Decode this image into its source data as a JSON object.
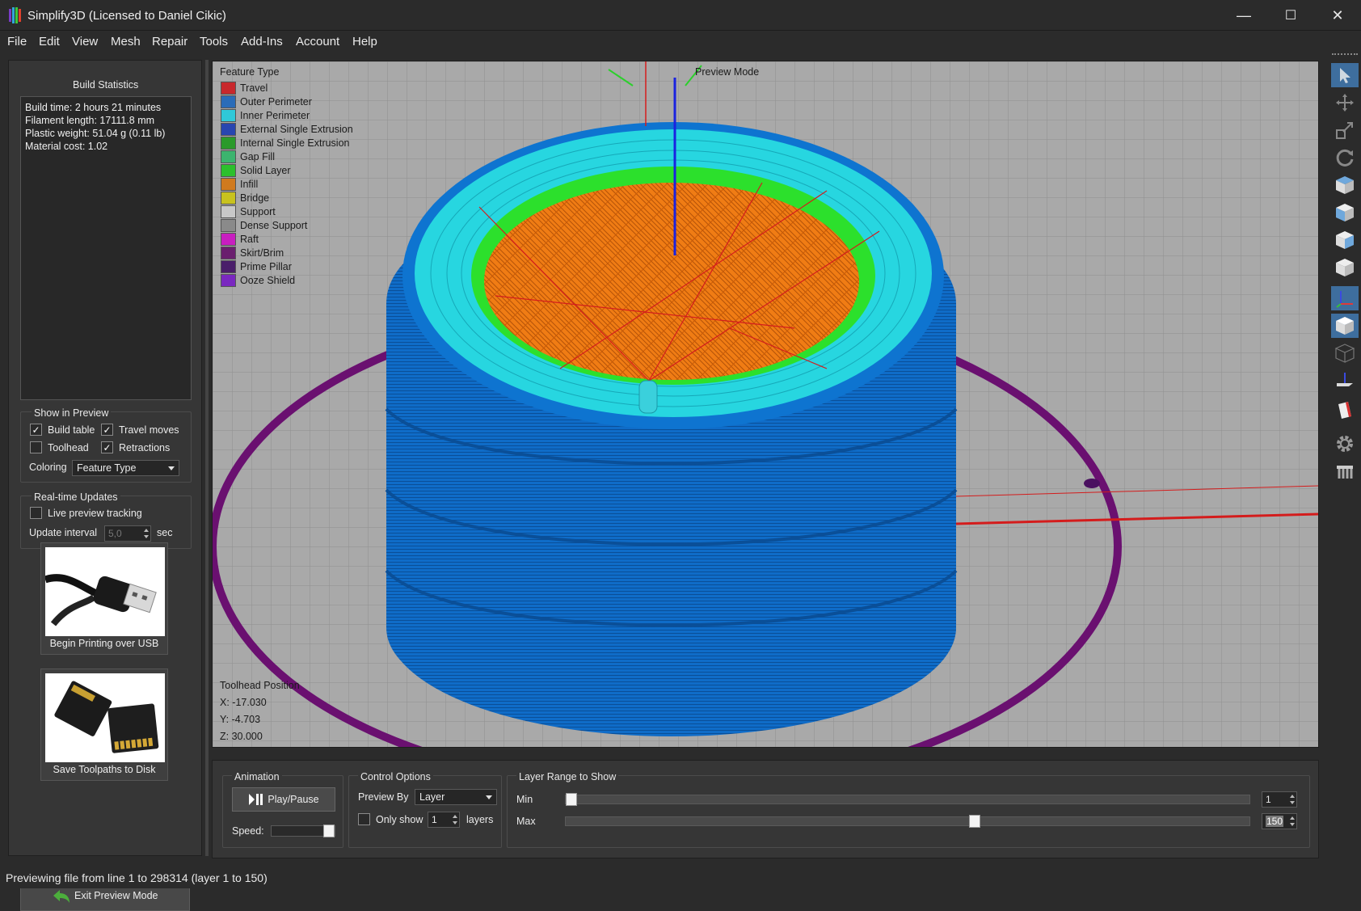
{
  "window": {
    "title": "Simplify3D (Licensed to Daniel Cikic)",
    "minimize": "—",
    "maximize": "☐",
    "close": "✕"
  },
  "menu": [
    "File",
    "Edit",
    "View",
    "Mesh",
    "Repair",
    "Tools",
    "Add-Ins",
    "Account",
    "Help"
  ],
  "build_stats": {
    "title": "Build Statistics",
    "lines": [
      "Build time: 2 hours 21 minutes",
      "Filament length: 17111.8 mm",
      "Plastic weight: 51.04 g (0.11 lb)",
      "Material cost: 1.02"
    ]
  },
  "show_in_preview": {
    "title": "Show in Preview",
    "build_table": {
      "label": "Build table",
      "checked": true
    },
    "travel_moves": {
      "label": "Travel moves",
      "checked": true
    },
    "toolhead": {
      "label": "Toolhead",
      "checked": false
    },
    "retractions": {
      "label": "Retractions",
      "checked": true
    },
    "coloring_label": "Coloring",
    "coloring_value": "Feature Type"
  },
  "realtime": {
    "title": "Real-time Updates",
    "live_label": "Live preview tracking",
    "live_checked": false,
    "interval_label": "Update interval",
    "interval_value": "5,0",
    "interval_unit": "sec"
  },
  "usb_button": {
    "label": "Begin Printing over USB"
  },
  "sd_button": {
    "label": "Save Toolpaths to Disk"
  },
  "exit_button": {
    "label": "Exit Preview Mode"
  },
  "viewport": {
    "legend_title": "Feature Type",
    "mode_label": "Preview Mode",
    "legend": [
      {
        "label": "Travel",
        "color": "#c8282c"
      },
      {
        "label": "Outer Perimeter",
        "color": "#2a6cb8"
      },
      {
        "label": "Inner Perimeter",
        "color": "#2fc8d8"
      },
      {
        "label": "External Single Extrusion",
        "color": "#2846b0"
      },
      {
        "label": "Internal Single Extrusion",
        "color": "#2a9a2a"
      },
      {
        "label": "Gap Fill",
        "color": "#3cb46e"
      },
      {
        "label": "Solid Layer",
        "color": "#2cc02c"
      },
      {
        "label": "Infill",
        "color": "#d07a1e"
      },
      {
        "label": "Bridge",
        "color": "#c8c21e"
      },
      {
        "label": "Support",
        "color": "#c8c8c8"
      },
      {
        "label": "Dense Support",
        "color": "#8a8a8a"
      },
      {
        "label": "Raft",
        "color": "#c81ec0"
      },
      {
        "label": "Skirt/Brim",
        "color": "#6a1e6e"
      },
      {
        "label": "Prime Pillar",
        "color": "#4a1e6a"
      },
      {
        "label": "Ooze Shield",
        "color": "#7a28c0"
      }
    ],
    "toolhead_title": "Toolhead Position",
    "toolhead": [
      "X: -17.030",
      "Y: -4.703",
      "Z: 30.000"
    ]
  },
  "animation": {
    "title": "Animation",
    "play_label": "Play/Pause",
    "speed_label": "Speed:",
    "speed_level": 1.0
  },
  "control": {
    "title": "Control Options",
    "preview_by_label": "Preview By",
    "preview_by_value": "Layer",
    "only_show_label": "Only show",
    "only_show_checked": false,
    "only_show_value": "1",
    "layers_label": "layers"
  },
  "layer_range": {
    "title": "Layer Range to Show",
    "min_label": "Min",
    "max_label": "Max",
    "min_value": "1",
    "max_value": "150",
    "total_layers": 150,
    "min_level": 0.0,
    "max_level": 0.6
  },
  "status": "Previewing file from line 1 to 298314 (layer 1 to 150)"
}
